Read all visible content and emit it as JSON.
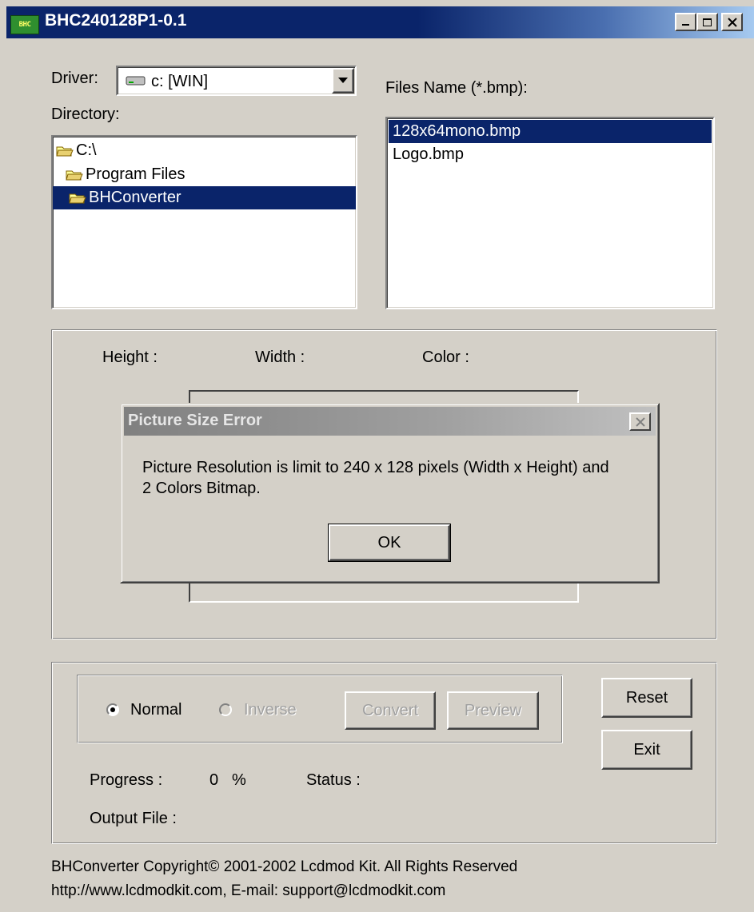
{
  "window": {
    "title": "BHC240128P1-0.1",
    "icon_text": "BHC"
  },
  "driver": {
    "label": "Driver:",
    "selected": "c: [WIN]"
  },
  "directory": {
    "label": "Directory:",
    "items": [
      {
        "label": "C:\\"
      },
      {
        "label": "Program Files"
      },
      {
        "label": "BHConverter"
      }
    ]
  },
  "files": {
    "label": "Files Name (*.bmp):",
    "items": [
      {
        "label": "128x64mono.bmp"
      },
      {
        "label": "Logo.bmp"
      }
    ]
  },
  "info": {
    "height_label": "Height :",
    "width_label": "Width :",
    "color_label": "Color :"
  },
  "dialog": {
    "title": "Picture Size Error",
    "message_line1": "Picture Resolution is limit to 240 x 128 pixels (Width x Height) and",
    "message_line2": "2 Colors Bitmap.",
    "ok_label": "OK"
  },
  "controls": {
    "normal_label": "Normal",
    "inverse_label": "Inverse",
    "convert_label": "Convert",
    "preview_label": "Preview",
    "reset_label": "Reset",
    "exit_label": "Exit",
    "progress_label": "Progress :",
    "progress_value": "0",
    "progress_unit": "%",
    "status_label": "Status :",
    "output_label": "Output File :"
  },
  "footer": {
    "line1": "BHConverter Copyright©  2001-2002 Lcdmod Kit. All Rights Reserved",
    "line2": "http://www.lcdmodkit.com, E-mail: support@lcdmodkit.com"
  },
  "colors": {
    "title_bar": "#0a246a",
    "selection": "#0a246a",
    "face": "#d4d0c8"
  }
}
